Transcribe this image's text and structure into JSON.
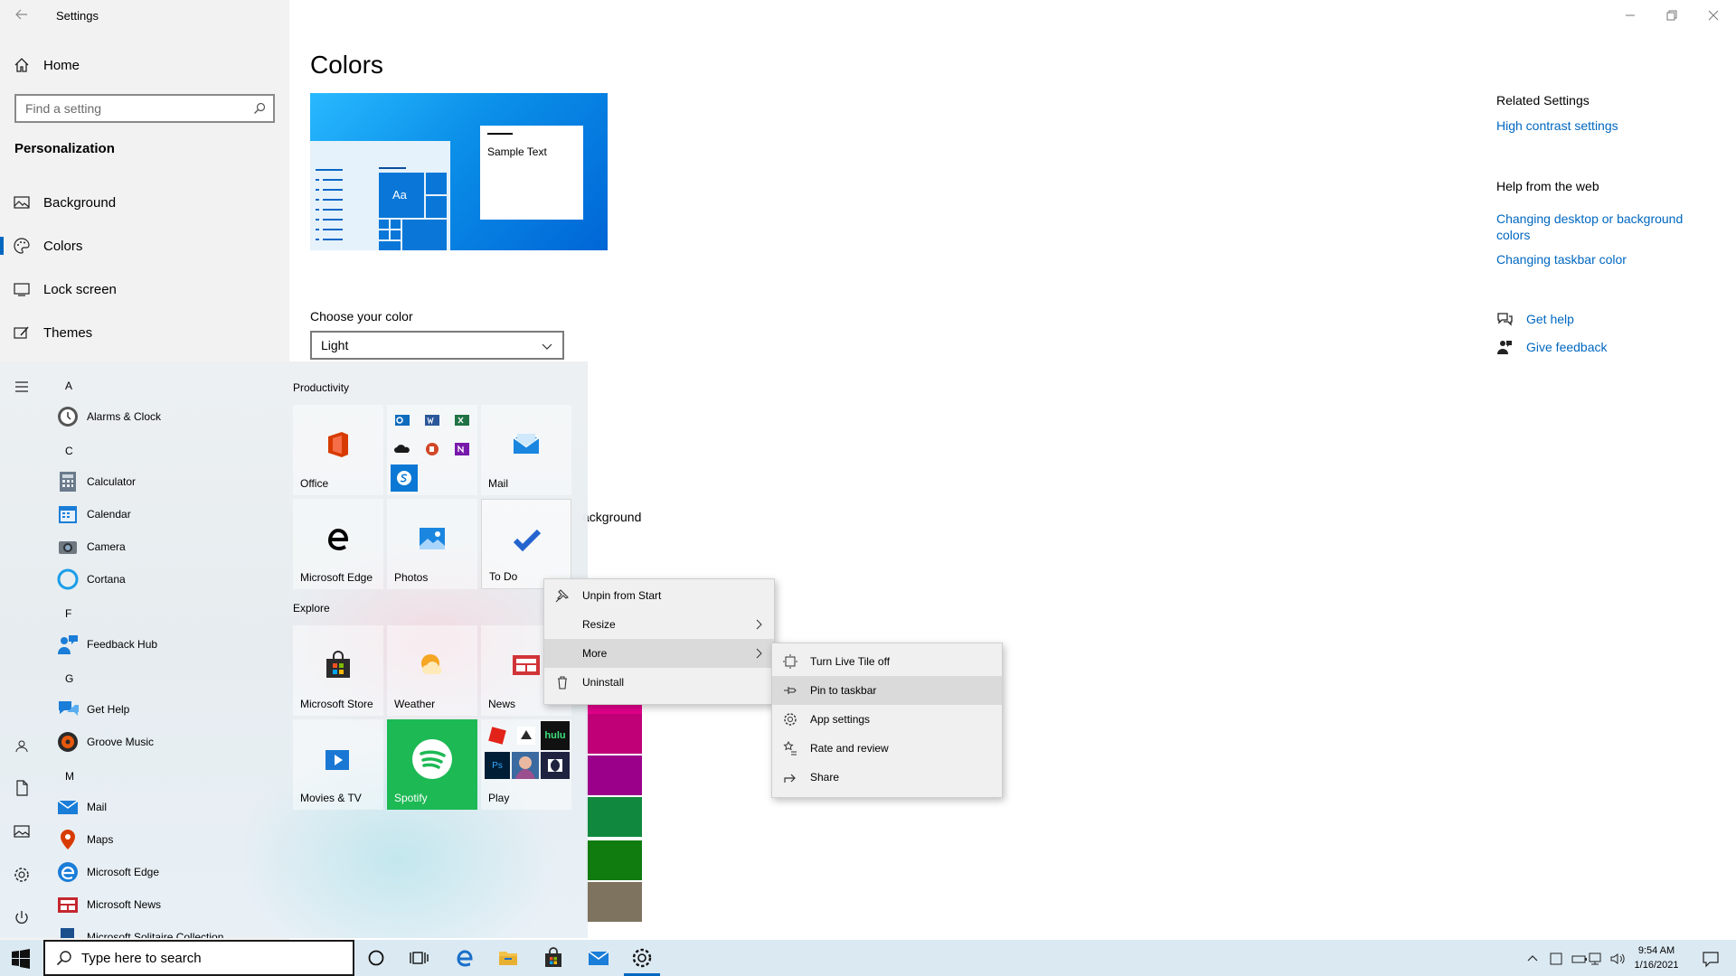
{
  "window": {
    "title": "Settings"
  },
  "sidebar": {
    "home": "Home",
    "search_placeholder": "Find a setting",
    "section": "Personalization",
    "items": [
      "Background",
      "Colors",
      "Lock screen",
      "Themes"
    ]
  },
  "main": {
    "title": "Colors",
    "preview_sample": "Sample Text",
    "preview_tile": "Aa",
    "choose_label": "Choose your color",
    "choose_value": "Light",
    "partial_text": "ackground"
  },
  "related": {
    "heading": "Related Settings",
    "link": "High contrast settings",
    "web_heading": "Help from the web",
    "web_links": [
      "Changing desktop or background colors",
      "Changing taskbar color"
    ],
    "get_help": "Get help",
    "give_feedback": "Give feedback"
  },
  "start_menu": {
    "letters": [
      "A",
      "C",
      "F",
      "G",
      "M"
    ],
    "apps": [
      "Alarms & Clock",
      "Calculator",
      "Calendar",
      "Camera",
      "Cortana",
      "Feedback Hub",
      "Get Help",
      "Groove Music",
      "Mail",
      "Maps",
      "Microsoft Edge",
      "Microsoft News",
      "Microsoft Solitaire Collection"
    ],
    "group_productivity": "Productivity",
    "group_explore": "Explore",
    "tiles": [
      "Office",
      "Mail",
      "Microsoft Edge",
      "Photos",
      "To Do",
      "Microsoft Store",
      "Weather",
      "News",
      "Movies & TV",
      "Spotify",
      "Play"
    ],
    "hulu_label": "hulu",
    "ps_label": "Ps"
  },
  "context_menu": {
    "items": [
      "Unpin from Start",
      "Resize",
      "More",
      "Uninstall"
    ]
  },
  "sub_menu": {
    "items": [
      "Turn Live Tile off",
      "Pin to taskbar",
      "App settings",
      "Rate and review",
      "Share"
    ]
  },
  "taskbar": {
    "search_placeholder": "Type here to search",
    "time": "9:54 AM",
    "date": "1/16/2021"
  },
  "colors": {
    "accent": "#0067c0",
    "swatches": [
      "#e3008c",
      "#bf0077",
      "#9a0089",
      "#881798",
      "#00b7c3",
      "#10893e",
      "#107c10",
      "#7e735f"
    ]
  }
}
